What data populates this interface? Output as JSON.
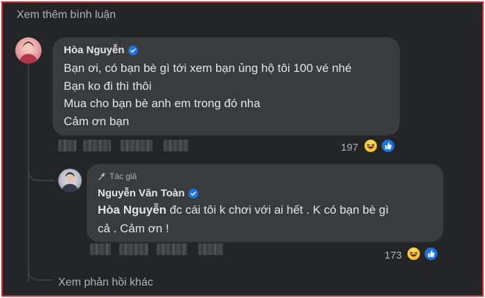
{
  "see_more_comments": "Xem thêm bình luận",
  "comments": [
    {
      "author": "Hòa Nguyễn",
      "lines": [
        "Bạn ơi, có bạn bè gì tới xem bạn ủng hộ tôi 100 vé nhé",
        "Bạn ko đi thì thôi",
        "Mua cho bạn bè anh em trong đó nha",
        "Cảm ơn bạn"
      ],
      "reaction_count": "197",
      "reactions": [
        "haha-icon",
        "like-icon"
      ]
    },
    {
      "badge": "Tác giả",
      "author": "Nguyễn Văn Toàn",
      "mention": "Hòa Nguyễn",
      "lines": [
        " đc cái tôi k chơi với ai hết . K có bạn bè gì",
        "cả . Cảm ơn !"
      ],
      "reaction_count": "173",
      "reactions": [
        "haha-icon",
        "like-icon"
      ]
    }
  ],
  "view_more_replies": "Xem phản hồi khác",
  "colors": {
    "background": "#242526",
    "bubble": "#3a3b3c",
    "text": "#e4e6eb",
    "secondary_text": "#b0b3b8",
    "verified": "#1b74e4",
    "border": "#e3262b"
  }
}
